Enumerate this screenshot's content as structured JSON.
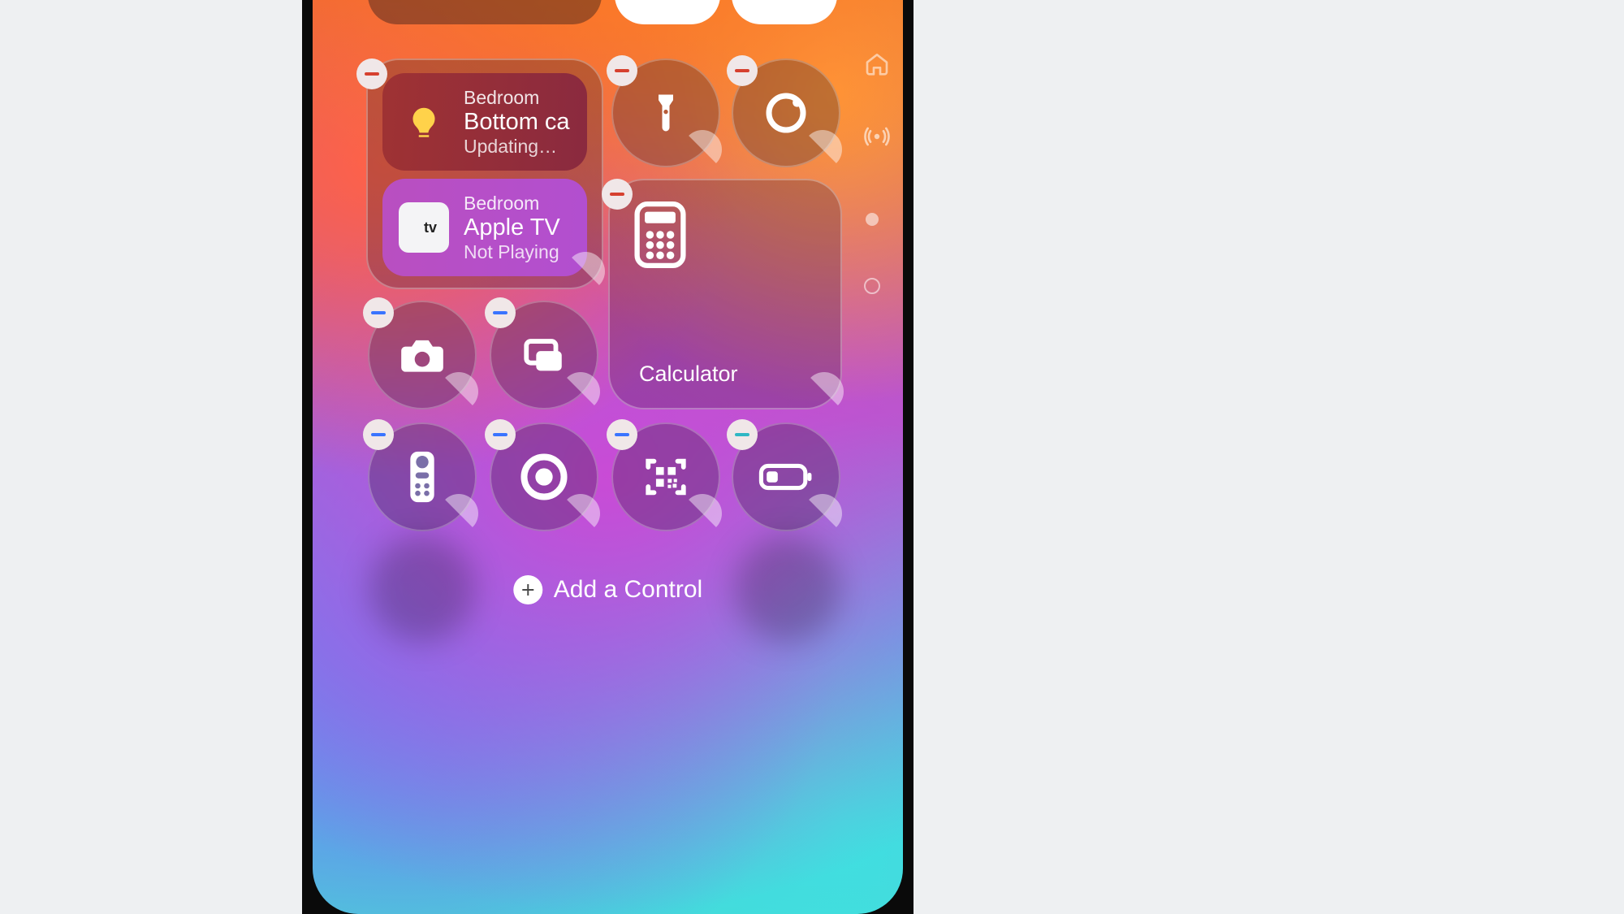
{
  "add_control_label": "Add a Control",
  "calculator_label": "Calculator",
  "home": {
    "row1": {
      "room": "Bedroom",
      "name": "Bottom cand",
      "status": "Updating…"
    },
    "row2": {
      "room": "Bedroom",
      "name": "Apple TV",
      "status": "Not Playing",
      "badge": "tv"
    }
  },
  "remove_badge_colors": {
    "red": "#d6402f",
    "blue": "#3a74ff",
    "teal": "#2fb7c4"
  },
  "controls": {
    "flashlight": "flashlight-icon",
    "timer": "timer-icon",
    "camera": "camera-icon",
    "screencast": "screen-mirroring-icon",
    "remote": "remote-icon",
    "record": "screen-record-icon",
    "qr": "qr-scan-icon",
    "battery": "low-power-icon",
    "calculator": "calculator-icon"
  },
  "side_indicators": [
    "home-icon",
    "connectivity-icon",
    "page-dot-filled",
    "page-dot-outline"
  ],
  "colors": {
    "bulb": "#ffd24a",
    "row1_bg": "linear-gradient(95deg,#a23233,#8a2a3f)",
    "row2_bg": "linear-gradient(95deg,#b94fc0,#b24fd0)"
  }
}
